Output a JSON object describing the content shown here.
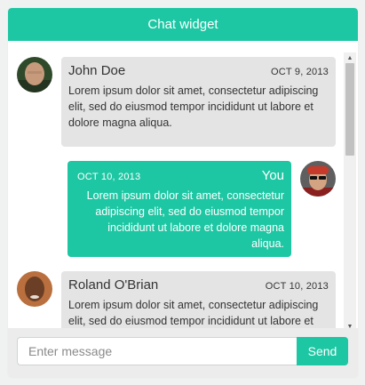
{
  "header": {
    "title": "Chat widget"
  },
  "messages": [
    {
      "sender": "John Doe",
      "date": "OCT 9, 2013",
      "text": "Lorem ipsum dolor sit amet, consectetur adipiscing elit, sed do eiusmod tempor incididunt ut labore et dolore magna aliqua.",
      "side": "left"
    },
    {
      "sender": "You",
      "date": "OCT 10, 2013",
      "text": "Lorem ipsum dolor sit amet, consectetur adipiscing elit, sed do eiusmod tempor incididunt ut labore et dolore magna aliqua.",
      "side": "right"
    },
    {
      "sender": "Roland O'Brian",
      "date": "OCT 10, 2013",
      "text": "Lorem ipsum dolor sit amet, consectetur adipiscing elit, sed do eiusmod tempor incididunt ut labore et dolore magna aliqua.",
      "side": "left"
    }
  ],
  "composer": {
    "placeholder": "Enter message",
    "value": "",
    "send_label": "Send"
  },
  "colors": {
    "accent": "#1dc7a3",
    "bubble_gray": "#e4e4e4"
  },
  "scrollbar": {
    "up_icon": "triangle-up-icon",
    "down_icon": "triangle-down-icon"
  }
}
